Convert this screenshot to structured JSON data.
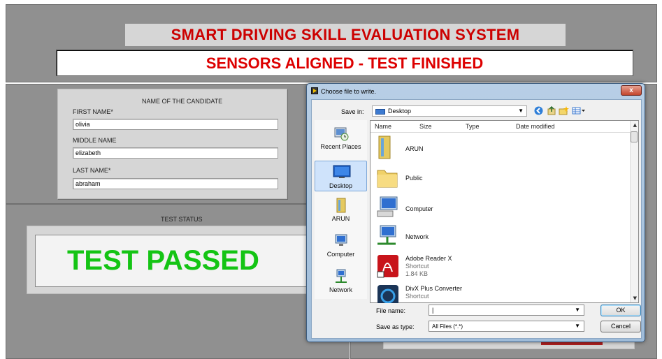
{
  "app": {
    "title": "SMART DRIVING SKILL EVALUATION SYSTEM",
    "status": "SENSORS ALIGNED - TEST FINISHED"
  },
  "candidate": {
    "section_title": "NAME OF THE CANDIDATE",
    "first_label": "FIRST NAME*",
    "first_value": "olivia",
    "middle_label": "MIDDLE NAME",
    "middle_value": "elizabeth",
    "last_label": "LAST NAME*",
    "last_value": "abraham"
  },
  "test": {
    "status_label": "TEST STATUS",
    "result": "TEST PASSED",
    "result_color": "#14c414"
  },
  "dialog": {
    "title": "Choose file to write.",
    "close_glyph": "x",
    "save_in_label": "Save in:",
    "save_in_value": "Desktop",
    "places": [
      {
        "label": "Recent Places",
        "icon": "recent-places-icon"
      },
      {
        "label": "Desktop",
        "icon": "desktop-icon"
      },
      {
        "label": "ARUN",
        "icon": "user-folder-icon"
      },
      {
        "label": "Computer",
        "icon": "computer-icon"
      },
      {
        "label": "Network",
        "icon": "network-icon"
      }
    ],
    "columns": [
      "Name",
      "Size",
      "Type",
      "Date modified"
    ],
    "files": [
      {
        "name": "ARUN",
        "icon": "user-folder-icon"
      },
      {
        "name": "Public",
        "icon": "folder-icon"
      },
      {
        "name": "Computer",
        "icon": "computer-icon"
      },
      {
        "name": "Network",
        "icon": "network-icon"
      },
      {
        "name": "Adobe Reader X",
        "sub1": "Shortcut",
        "sub2": "1.84 KB",
        "icon": "pdf-shortcut-icon"
      },
      {
        "name": "DivX Plus Converter",
        "sub1": "Shortcut",
        "icon": "divx-shortcut-icon"
      }
    ],
    "file_name_label": "File name:",
    "file_name_value": "",
    "save_type_label": "Save as type:",
    "save_type_value": "All Files (*.*)",
    "ok_label": "OK",
    "cancel_label": "Cancel"
  },
  "colors": {
    "title_red": "#cc0000",
    "panel_gray": "#909090",
    "accent_blue": "#3c7ad0"
  }
}
